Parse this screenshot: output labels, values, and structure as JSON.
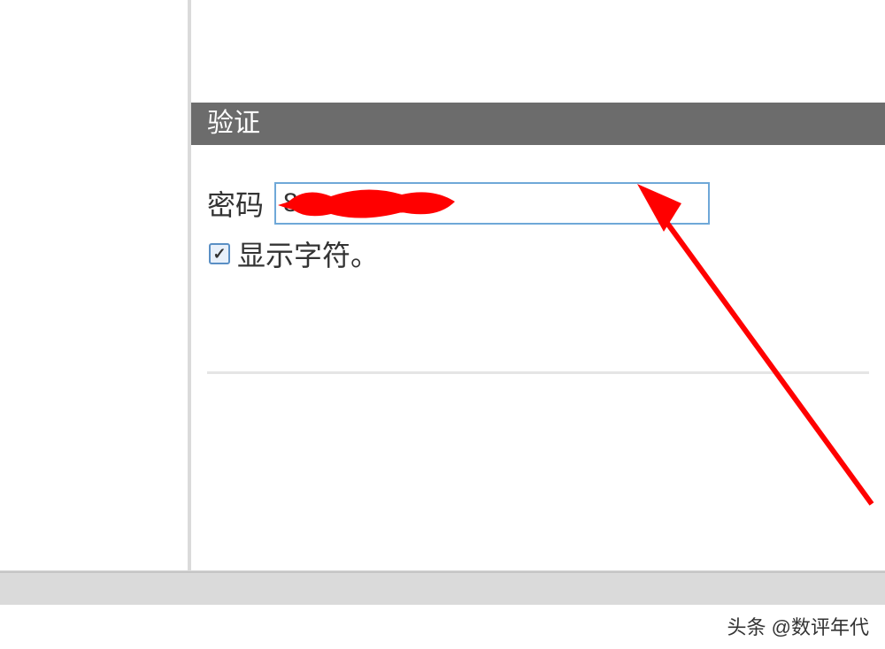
{
  "verification": {
    "header": "验证",
    "password_label": "密码",
    "password_value": "8",
    "show_chars_label": "显示字符。",
    "show_chars_checked": true
  },
  "watermark": {
    "text": "头条 @数评年代"
  }
}
